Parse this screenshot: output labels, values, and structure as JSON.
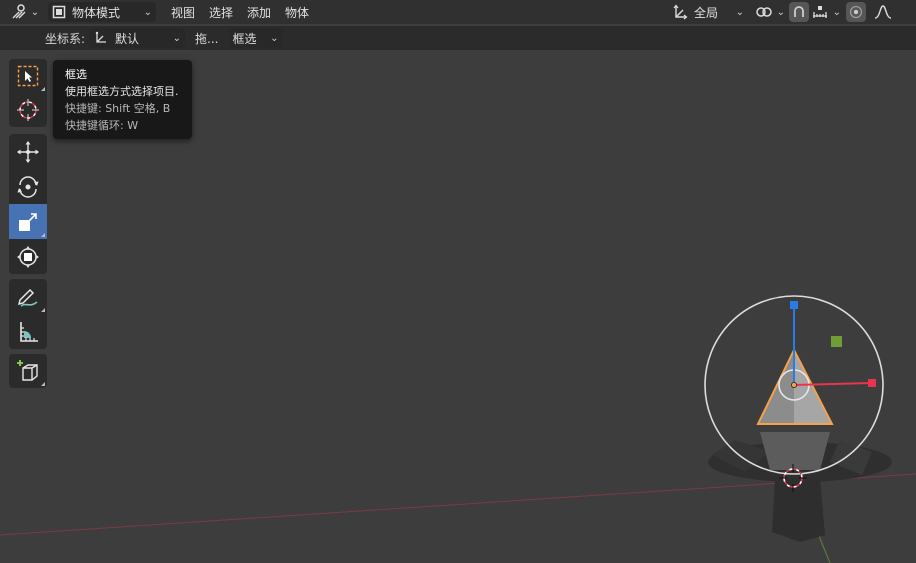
{
  "header": {
    "mode_label": "物体模式",
    "menus": [
      "视图",
      "选择",
      "添加",
      "物体"
    ],
    "transform_orientation": "全局"
  },
  "tool_header": {
    "coord_label": "坐标系:",
    "coord_value": "默认",
    "drag_label": "拖...",
    "drag_value": "框选"
  },
  "tooltip": {
    "title": "框选",
    "description": "使用框选方式选择项目.",
    "shortcut": "快捷键: Shift 空格, B",
    "cycle": "快捷键循环: W"
  },
  "colors": {
    "active_tool": "#4772b3",
    "selection_outline": "#f5a24a",
    "axis_x": "#e8344f",
    "axis_y": "#7fb13c",
    "axis_z": "#2a7be8"
  },
  "icons": [
    "tool-settings-icon",
    "object-mode-icon",
    "orientation-icon",
    "snap-icon",
    "proportional-edit-icon",
    "select-box-icon",
    "cursor-icon",
    "move-icon",
    "rotate-icon",
    "scale-icon",
    "transform-icon",
    "annotate-icon",
    "measure-icon",
    "add-cube-icon"
  ]
}
